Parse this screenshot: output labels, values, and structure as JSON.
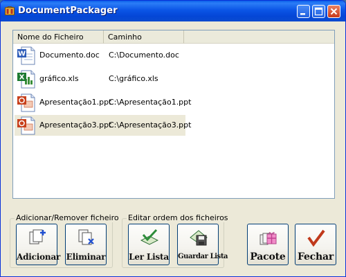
{
  "window": {
    "title": "DocumentPackager"
  },
  "list": {
    "columns": [
      "Nome do Ficheiro",
      "Caminho"
    ],
    "rows": [
      {
        "name": "Documento.doc",
        "path": "C:\\Documento.doc",
        "icon": "word-document-icon"
      },
      {
        "name": "gráfico.xls",
        "path": "C:\\gráfico.xls",
        "icon": "excel-spreadsheet-icon"
      },
      {
        "name": "Apresentação1.ppt",
        "path": "C:\\Apresentação1.ppt",
        "icon": "powerpoint-presentation-icon"
      },
      {
        "name": "Apresentação3.ppt",
        "path": "C:\\Apresentação3.ppt",
        "icon": "powerpoint-presentation-icon",
        "selected": true
      }
    ]
  },
  "groups": {
    "add_remove": {
      "label": "Adicionar/Remover ficheiro",
      "add": "Adicionar",
      "remove": "Eliminar"
    },
    "edit_order": {
      "label": "Editar ordem dos ficheiros",
      "read": "Ler Lista",
      "save": "Guardar Lista"
    }
  },
  "actions": {
    "package": "Pacote",
    "close": "Fechar"
  },
  "colors": {
    "titlebar": "#0b55e6",
    "window_bg": "#ece9d8",
    "selected_row": "#ece9d8",
    "accent_check": "#c0391b"
  }
}
